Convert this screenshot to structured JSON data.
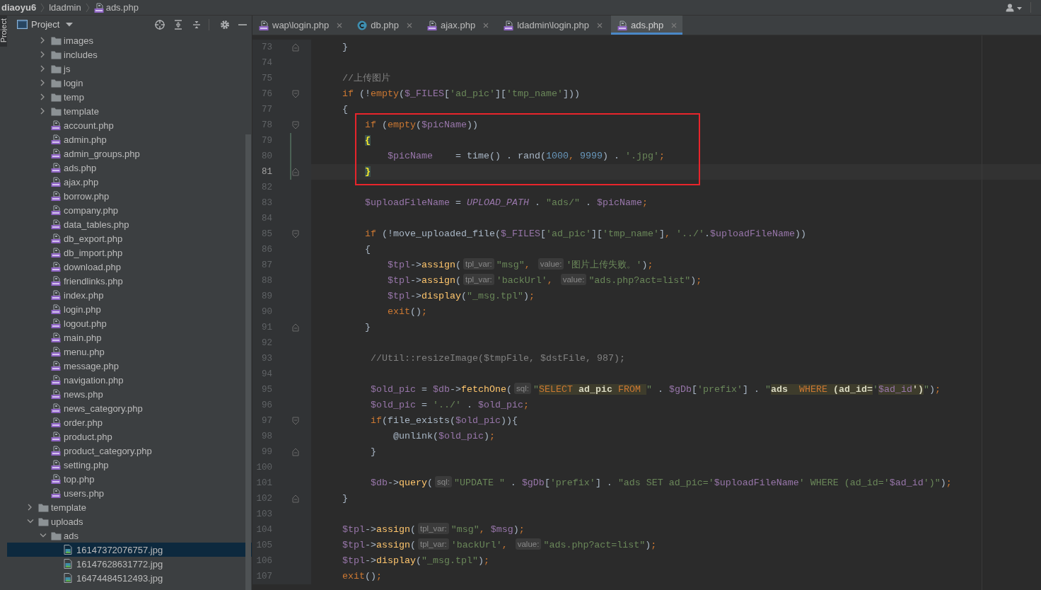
{
  "breadcrumb": [
    {
      "text": "diaoyu6",
      "kind": "project"
    },
    {
      "text": "ldadmin",
      "kind": "folder"
    },
    {
      "text": "ads.php",
      "kind": "php"
    }
  ],
  "tool_strip": {
    "label": "Project"
  },
  "project_panel": {
    "title": "Project",
    "tree": [
      {
        "children": [
          {
            "name": "images",
            "kind": "folder",
            "expanded": false,
            "selected": false
          },
          {
            "name": "includes",
            "kind": "folder",
            "expanded": false,
            "selected": false
          },
          {
            "name": "js",
            "kind": "folder",
            "expanded": false,
            "selected": false
          },
          {
            "name": "login",
            "kind": "folder",
            "expanded": false,
            "selected": false
          },
          {
            "name": "temp",
            "kind": "folder",
            "expanded": false,
            "selected": false
          },
          {
            "name": "template",
            "kind": "folder",
            "expanded": false,
            "selected": false
          },
          {
            "name": "account.php",
            "kind": "php",
            "selected": false
          },
          {
            "name": "admin.php",
            "kind": "php",
            "selected": false
          },
          {
            "name": "admin_groups.php",
            "kind": "php",
            "selected": false
          },
          {
            "name": "ads.php",
            "kind": "php",
            "selected": false
          },
          {
            "name": "ajax.php",
            "kind": "php",
            "selected": false
          },
          {
            "name": "borrow.php",
            "kind": "php",
            "selected": false
          },
          {
            "name": "company.php",
            "kind": "php",
            "selected": false
          },
          {
            "name": "data_tables.php",
            "kind": "php",
            "selected": false
          },
          {
            "name": "db_export.php",
            "kind": "php",
            "selected": false
          },
          {
            "name": "db_import.php",
            "kind": "php",
            "selected": false
          },
          {
            "name": "download.php",
            "kind": "php",
            "selected": false
          },
          {
            "name": "friendlinks.php",
            "kind": "php",
            "selected": false
          },
          {
            "name": "index.php",
            "kind": "php",
            "selected": false
          },
          {
            "name": "login.php",
            "kind": "php",
            "selected": false
          },
          {
            "name": "logout.php",
            "kind": "php",
            "selected": false
          },
          {
            "name": "main.php",
            "kind": "php",
            "selected": false
          },
          {
            "name": "menu.php",
            "kind": "php",
            "selected": false
          },
          {
            "name": "message.php",
            "kind": "php",
            "selected": false
          },
          {
            "name": "navigation.php",
            "kind": "php",
            "selected": false
          },
          {
            "name": "news.php",
            "kind": "php",
            "selected": false
          },
          {
            "name": "news_category.php",
            "kind": "php",
            "selected": false
          },
          {
            "name": "order.php",
            "kind": "php",
            "selected": false
          },
          {
            "name": "product.php",
            "kind": "php",
            "selected": false
          },
          {
            "name": "product_category.php",
            "kind": "php",
            "selected": false
          },
          {
            "name": "setting.php",
            "kind": "php",
            "selected": false
          },
          {
            "name": "top.php",
            "kind": "php",
            "selected": false
          },
          {
            "name": "users.php",
            "kind": "php",
            "selected": false
          }
        ]
      },
      {
        "name": "template",
        "kind": "folder",
        "expanded": false,
        "selected": false
      },
      {
        "name": "uploads",
        "kind": "folder",
        "expanded": true,
        "selected": false,
        "children": [
          {
            "name": "ads",
            "kind": "folder",
            "expanded": true,
            "selected": false,
            "children": [
              {
                "name": "16147372076757.jpg",
                "kind": "image",
                "selected": true
              },
              {
                "name": "16147628631772.jpg",
                "kind": "image",
                "selected": false
              },
              {
                "name": "16474484512493.jpg",
                "kind": "image",
                "selected": false
              }
            ]
          }
        ]
      }
    ]
  },
  "editor": {
    "tabs": [
      {
        "label": "wap\\login.php",
        "kind": "php",
        "selected": false
      },
      {
        "label": "db.php",
        "kind": "class",
        "selected": false
      },
      {
        "label": "ajax.php",
        "kind": "php",
        "selected": false
      },
      {
        "label": "ldadmin\\login.php",
        "kind": "php",
        "selected": false
      },
      {
        "label": "ads.php",
        "kind": "php",
        "selected": true
      }
    ],
    "lines": [
      {
        "n": "73",
        "fold_start": false,
        "fold_end": true,
        "modified": false,
        "current": false,
        "boxed": false,
        "tokens": [
          {
            "kind": "p",
            "text": "    }"
          }
        ]
      },
      {
        "n": "74",
        "fold_start": false,
        "fold_end": false,
        "modified": false,
        "current": false,
        "boxed": false
      },
      {
        "n": "75",
        "fold_start": false,
        "fold_end": false,
        "modified": false,
        "current": false,
        "boxed": false,
        "tokens": [
          {
            "kind": "c",
            "text": "    //上传图片"
          }
        ]
      },
      {
        "n": "76",
        "fold_start": true,
        "fold_end": false,
        "modified": false,
        "current": false,
        "boxed": false,
        "tokens": [
          {
            "kind": "k",
            "text": "    if "
          },
          {
            "kind": "p",
            "text": "(!"
          },
          {
            "kind": "k",
            "text": "empty"
          },
          {
            "kind": "p",
            "text": "("
          },
          {
            "kind": "v",
            "text": "$_FILES"
          },
          {
            "kind": "p",
            "text": "["
          },
          {
            "kind": "s",
            "text": "'ad_pic'"
          },
          {
            "kind": "p",
            "text": "]["
          },
          {
            "kind": "s",
            "text": "'tmp_name'"
          },
          {
            "kind": "p",
            "text": "]))"
          }
        ]
      },
      {
        "n": "77",
        "fold_start": false,
        "fold_end": false,
        "modified": false,
        "current": false,
        "boxed": false,
        "tokens": [
          {
            "kind": "p",
            "text": "    {"
          }
        ]
      },
      {
        "n": "78",
        "fold_start": true,
        "fold_end": false,
        "modified": false,
        "current": false,
        "boxed": true,
        "tokens": [
          {
            "kind": "k",
            "text": "        if "
          },
          {
            "kind": "p",
            "text": "("
          },
          {
            "kind": "k",
            "text": "empty"
          },
          {
            "kind": "p",
            "text": "("
          },
          {
            "kind": "v",
            "text": "$picName"
          },
          {
            "kind": "p",
            "text": "))"
          }
        ]
      },
      {
        "n": "79",
        "fold_start": false,
        "fold_end": false,
        "modified": true,
        "current": false,
        "boxed": true,
        "tokens": [
          {
            "kind": "b",
            "text": "        {"
          }
        ]
      },
      {
        "n": "80",
        "fold_start": false,
        "fold_end": false,
        "modified": true,
        "current": false,
        "boxed": true,
        "tokens": [
          {
            "kind": "v",
            "text": "            $picName"
          },
          {
            "kind": "p",
            "text": "    = time() . rand("
          },
          {
            "kind": "n",
            "text": "1000"
          },
          {
            "kind": "d",
            "text": ", "
          },
          {
            "kind": "n",
            "text": "9999"
          },
          {
            "kind": "p",
            "text": ") . "
          },
          {
            "kind": "s",
            "text": "'.jpg'"
          },
          {
            "kind": "d",
            "text": ";"
          }
        ]
      },
      {
        "n": "81",
        "fold_start": false,
        "fold_end": true,
        "modified": true,
        "current": true,
        "boxed": true,
        "tokens": [
          {
            "kind": "b",
            "text": "        }"
          }
        ]
      },
      {
        "n": "82",
        "fold_start": false,
        "fold_end": false,
        "modified": false,
        "current": false,
        "boxed": false
      },
      {
        "n": "83",
        "fold_start": false,
        "fold_end": false,
        "modified": false,
        "current": false,
        "boxed": false,
        "tokens": [
          {
            "kind": "v",
            "text": "        $uploadFileName"
          },
          {
            "kind": "p",
            "text": " = "
          },
          {
            "kind": "i",
            "text": "UPLOAD_PATH"
          },
          {
            "kind": "p",
            "text": " . "
          },
          {
            "kind": "s",
            "text": "\"ads/\""
          },
          {
            "kind": "p",
            "text": " . "
          },
          {
            "kind": "v",
            "text": "$picName"
          },
          {
            "kind": "d",
            "text": ";"
          }
        ]
      },
      {
        "n": "84",
        "fold_start": false,
        "fold_end": false,
        "modified": false,
        "current": false,
        "boxed": false
      },
      {
        "n": "85",
        "fold_start": true,
        "fold_end": false,
        "modified": false,
        "current": false,
        "boxed": false,
        "tokens": [
          {
            "kind": "k",
            "text": "        if "
          },
          {
            "kind": "p",
            "text": "(!move_uploaded_file("
          },
          {
            "kind": "v",
            "text": "$_FILES"
          },
          {
            "kind": "p",
            "text": "["
          },
          {
            "kind": "s",
            "text": "'ad_pic'"
          },
          {
            "kind": "p",
            "text": "]["
          },
          {
            "kind": "s",
            "text": "'tmp_name'"
          },
          {
            "kind": "p",
            "text": "]"
          },
          {
            "kind": "d",
            "text": ", "
          },
          {
            "kind": "s",
            "text": "'../'"
          },
          {
            "kind": "p",
            "text": "."
          },
          {
            "kind": "v",
            "text": "$uploadFileName"
          },
          {
            "kind": "p",
            "text": "))"
          }
        ]
      },
      {
        "n": "86",
        "fold_start": false,
        "fold_end": false,
        "modified": false,
        "current": false,
        "boxed": false,
        "tokens": [
          {
            "kind": "p",
            "text": "        {"
          }
        ]
      },
      {
        "n": "87",
        "fold_start": false,
        "fold_end": false,
        "modified": false,
        "current": false,
        "boxed": false,
        "tokens": [
          {
            "kind": "v",
            "text": "            $tpl"
          },
          {
            "kind": "p",
            "text": "->"
          },
          {
            "kind": "m",
            "text": "assign"
          },
          {
            "kind": "p",
            "text": "("
          },
          {
            "kind": "h",
            "text": "tpl_var:"
          },
          {
            "kind": "s",
            "text": "\"msg\""
          },
          {
            "kind": "d",
            "text": ", "
          },
          {
            "kind": "h",
            "text": "value:"
          },
          {
            "kind": "s",
            "text": "'图片上传失败。'"
          },
          {
            "kind": "p",
            "text": ")"
          },
          {
            "kind": "d",
            "text": ";"
          }
        ]
      },
      {
        "n": "88",
        "fold_start": false,
        "fold_end": false,
        "modified": false,
        "current": false,
        "boxed": false,
        "tokens": [
          {
            "kind": "v",
            "text": "            $tpl"
          },
          {
            "kind": "p",
            "text": "->"
          },
          {
            "kind": "m",
            "text": "assign"
          },
          {
            "kind": "p",
            "text": "("
          },
          {
            "kind": "h",
            "text": "tpl_var:"
          },
          {
            "kind": "s",
            "text": "'backUrl'"
          },
          {
            "kind": "d",
            "text": ", "
          },
          {
            "kind": "h",
            "text": "value:"
          },
          {
            "kind": "s",
            "text": "\"ads.php?act=list\""
          },
          {
            "kind": "p",
            "text": ")"
          },
          {
            "kind": "d",
            "text": ";"
          }
        ]
      },
      {
        "n": "89",
        "fold_start": false,
        "fold_end": false,
        "modified": false,
        "current": false,
        "boxed": false,
        "tokens": [
          {
            "kind": "v",
            "text": "            $tpl"
          },
          {
            "kind": "p",
            "text": "->"
          },
          {
            "kind": "m",
            "text": "display"
          },
          {
            "kind": "p",
            "text": "("
          },
          {
            "kind": "s",
            "text": "\"_msg.tpl\""
          },
          {
            "kind": "p",
            "text": ")"
          },
          {
            "kind": "d",
            "text": ";"
          }
        ]
      },
      {
        "n": "90",
        "fold_start": false,
        "fold_end": false,
        "modified": false,
        "current": false,
        "boxed": false,
        "tokens": [
          {
            "kind": "k",
            "text": "            exit"
          },
          {
            "kind": "p",
            "text": "()"
          },
          {
            "kind": "d",
            "text": ";"
          }
        ]
      },
      {
        "n": "91",
        "fold_start": false,
        "fold_end": true,
        "modified": false,
        "current": false,
        "boxed": false,
        "tokens": [
          {
            "kind": "p",
            "text": "        }"
          }
        ]
      },
      {
        "n": "92",
        "fold_start": false,
        "fold_end": false,
        "modified": false,
        "current": false,
        "boxed": false
      },
      {
        "n": "93",
        "fold_start": false,
        "fold_end": false,
        "modified": false,
        "current": false,
        "boxed": false,
        "tokens": [
          {
            "kind": "c",
            "text": "         //Util::resizeImage($tmpFile, $dstFile, 987);"
          }
        ]
      },
      {
        "n": "94",
        "fold_start": false,
        "fold_end": false,
        "modified": false,
        "current": false,
        "boxed": false
      },
      {
        "n": "95",
        "fold_start": false,
        "fold_end": false,
        "modified": false,
        "current": false,
        "boxed": false,
        "tokens": [
          {
            "kind": "v",
            "text": "         $old_pic"
          },
          {
            "kind": "p",
            "text": " = "
          },
          {
            "kind": "v",
            "text": "$db"
          },
          {
            "kind": "p",
            "text": "->"
          },
          {
            "kind": "m",
            "text": "fetchOne"
          },
          {
            "kind": "p",
            "text": "("
          },
          {
            "kind": "h",
            "text": "sql:"
          },
          {
            "kind": "s",
            "text": "\""
          },
          {
            "kind": "q",
            "text": "SELECT "
          },
          {
            "kind": "r",
            "text": "ad_pic "
          },
          {
            "kind": "q",
            "text": "FROM "
          },
          {
            "kind": "s",
            "text": "\""
          },
          {
            "kind": "p",
            "text": " . "
          },
          {
            "kind": "v",
            "text": "$gDb"
          },
          {
            "kind": "p",
            "text": "["
          },
          {
            "kind": "s",
            "text": "'prefix'"
          },
          {
            "kind": "p",
            "text": "] . "
          },
          {
            "kind": "s",
            "text": "\""
          },
          {
            "kind": "r",
            "text": "ads  "
          },
          {
            "kind": "q",
            "text": "WHERE "
          },
          {
            "kind": "r",
            "text": "(ad_id="
          },
          {
            "kind": "s",
            "text": "'"
          },
          {
            "kind": "w",
            "text": "$ad_id"
          },
          {
            "kind": "r",
            "text": "')"
          },
          {
            "kind": "s",
            "text": "\""
          },
          {
            "kind": "p",
            "text": ")"
          },
          {
            "kind": "d",
            "text": ";"
          }
        ]
      },
      {
        "n": "96",
        "fold_start": false,
        "fold_end": false,
        "modified": false,
        "current": false,
        "boxed": false,
        "tokens": [
          {
            "kind": "v",
            "text": "         $old_pic"
          },
          {
            "kind": "p",
            "text": " = "
          },
          {
            "kind": "s",
            "text": "'../'"
          },
          {
            "kind": "p",
            "text": " . "
          },
          {
            "kind": "v",
            "text": "$old_pic"
          },
          {
            "kind": "d",
            "text": ";"
          }
        ]
      },
      {
        "n": "97",
        "fold_start": true,
        "fold_end": false,
        "modified": false,
        "current": false,
        "boxed": false,
        "tokens": [
          {
            "kind": "k",
            "text": "         if"
          },
          {
            "kind": "p",
            "text": "(file_exists("
          },
          {
            "kind": "v",
            "text": "$old_pic"
          },
          {
            "kind": "p",
            "text": ")){"
          }
        ]
      },
      {
        "n": "98",
        "fold_start": false,
        "fold_end": false,
        "modified": false,
        "current": false,
        "boxed": false,
        "tokens": [
          {
            "kind": "p",
            "text": "             @unlink("
          },
          {
            "kind": "v",
            "text": "$old_pic"
          },
          {
            "kind": "p",
            "text": ")"
          },
          {
            "kind": "d",
            "text": ";"
          }
        ]
      },
      {
        "n": "99",
        "fold_start": false,
        "fold_end": true,
        "modified": false,
        "current": false,
        "boxed": false,
        "tokens": [
          {
            "kind": "p",
            "text": "         }"
          }
        ]
      },
      {
        "n": "100",
        "fold_start": false,
        "fold_end": false,
        "modified": false,
        "current": false,
        "boxed": false
      },
      {
        "n": "101",
        "fold_start": false,
        "fold_end": false,
        "modified": false,
        "current": false,
        "boxed": false,
        "tokens": [
          {
            "kind": "v",
            "text": "         $db"
          },
          {
            "kind": "p",
            "text": "->"
          },
          {
            "kind": "m",
            "text": "query"
          },
          {
            "kind": "p",
            "text": "("
          },
          {
            "kind": "h",
            "text": "sql:"
          },
          {
            "kind": "s",
            "text": "\"UPDATE \""
          },
          {
            "kind": "p",
            "text": " . "
          },
          {
            "kind": "v",
            "text": "$gDb"
          },
          {
            "kind": "p",
            "text": "["
          },
          {
            "kind": "s",
            "text": "'prefix'"
          },
          {
            "kind": "p",
            "text": "] . "
          },
          {
            "kind": "s",
            "text": "\"ads SET ad_pic='"
          },
          {
            "kind": "v",
            "text": "$uploadFileName"
          },
          {
            "kind": "s",
            "text": "' WHERE (ad_id='"
          },
          {
            "kind": "v",
            "text": "$ad_id"
          },
          {
            "kind": "s",
            "text": "')\""
          },
          {
            "kind": "p",
            "text": ")"
          },
          {
            "kind": "d",
            "text": ";"
          }
        ]
      },
      {
        "n": "102",
        "fold_start": false,
        "fold_end": true,
        "modified": false,
        "current": false,
        "boxed": false,
        "tokens": [
          {
            "kind": "p",
            "text": "    }"
          }
        ]
      },
      {
        "n": "103",
        "fold_start": false,
        "fold_end": false,
        "modified": false,
        "current": false,
        "boxed": false
      },
      {
        "n": "104",
        "fold_start": false,
        "fold_end": false,
        "modified": false,
        "current": false,
        "boxed": false,
        "tokens": [
          {
            "kind": "v",
            "text": "    $tpl"
          },
          {
            "kind": "p",
            "text": "->"
          },
          {
            "kind": "m",
            "text": "assign"
          },
          {
            "kind": "p",
            "text": "("
          },
          {
            "kind": "h",
            "text": "tpl_var:"
          },
          {
            "kind": "s",
            "text": "\"msg\""
          },
          {
            "kind": "d",
            "text": ", "
          },
          {
            "kind": "v",
            "text": "$msg"
          },
          {
            "kind": "p",
            "text": ")"
          },
          {
            "kind": "d",
            "text": ";"
          }
        ]
      },
      {
        "n": "105",
        "fold_start": false,
        "fold_end": false,
        "modified": false,
        "current": false,
        "boxed": false,
        "tokens": [
          {
            "kind": "v",
            "text": "    $tpl"
          },
          {
            "kind": "p",
            "text": "->"
          },
          {
            "kind": "m",
            "text": "assign"
          },
          {
            "kind": "p",
            "text": "("
          },
          {
            "kind": "h",
            "text": "tpl_var:"
          },
          {
            "kind": "s",
            "text": "'backUrl'"
          },
          {
            "kind": "d",
            "text": ", "
          },
          {
            "kind": "h",
            "text": "value:"
          },
          {
            "kind": "s",
            "text": "\"ads.php?act=list\""
          },
          {
            "kind": "p",
            "text": ")"
          },
          {
            "kind": "d",
            "text": ";"
          }
        ]
      },
      {
        "n": "106",
        "fold_start": false,
        "fold_end": false,
        "modified": false,
        "current": false,
        "boxed": false,
        "tokens": [
          {
            "kind": "v",
            "text": "    $tpl"
          },
          {
            "kind": "p",
            "text": "->"
          },
          {
            "kind": "m",
            "text": "display"
          },
          {
            "kind": "p",
            "text": "("
          },
          {
            "kind": "s",
            "text": "\"_msg.tpl\""
          },
          {
            "kind": "p",
            "text": ")"
          },
          {
            "kind": "d",
            "text": ";"
          }
        ]
      },
      {
        "n": "107",
        "fold_start": false,
        "fold_end": false,
        "modified": false,
        "current": false,
        "boxed": false,
        "tokens": [
          {
            "kind": "k",
            "text": "    exit"
          },
          {
            "kind": "p",
            "text": "()"
          },
          {
            "kind": "d",
            "text": ";"
          }
        ]
      }
    ]
  }
}
